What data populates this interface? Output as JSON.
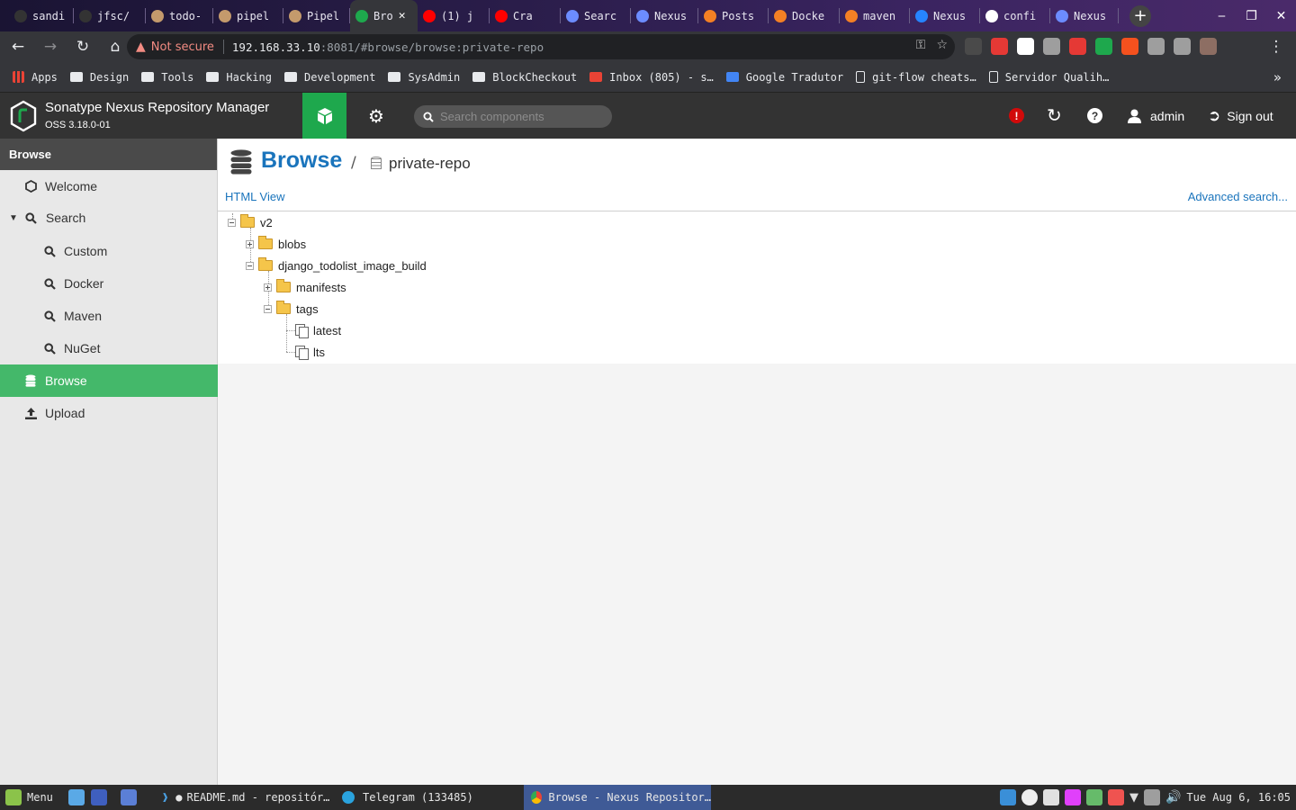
{
  "browser": {
    "tabs": [
      {
        "label": "sandi",
        "color": "#333333"
      },
      {
        "label": "jfsc/",
        "color": "#333333"
      },
      {
        "label": "todo-",
        "color": "#c49a6c"
      },
      {
        "label": "pipel",
        "color": "#c49a6c"
      },
      {
        "label": "Pipel",
        "color": "#c49a6c"
      },
      {
        "label": "Bro",
        "color": "#1ea84d",
        "active": true,
        "close": "✕"
      },
      {
        "label": "(1) j",
        "color": "#ff0000"
      },
      {
        "label": "Cra",
        "color": "#ff0000"
      },
      {
        "label": "Searc",
        "color": "#6c8cff"
      },
      {
        "label": "Nexus",
        "color": "#6c8cff"
      },
      {
        "label": "Posts",
        "color": "#f48024"
      },
      {
        "label": "Docke",
        "color": "#f48024"
      },
      {
        "label": "maven",
        "color": "#f48024"
      },
      {
        "label": "Nexus",
        "color": "#2684ff"
      },
      {
        "label": "confi",
        "color": "#ffffff"
      },
      {
        "label": "Nexus",
        "color": "#6c8cff"
      }
    ],
    "new_tab": "+",
    "window_controls": [
      "‒",
      "❐",
      "✕"
    ],
    "security_label": "Not secure",
    "url_host": "192.168.33.10",
    "url_rest": ":8081/#browse/browse:private-repo",
    "extension_colors": [
      "#4a4a4a",
      "#e53935",
      "#ffffff",
      "#9e9e9e",
      "#e53935",
      "#1ea84d",
      "#f4511e",
      "#9e9e9e",
      "#9e9e9e",
      "#8d6e63"
    ],
    "bookmarks": [
      {
        "label": "Apps",
        "icon": "apps"
      },
      {
        "label": "Design",
        "icon": "folder"
      },
      {
        "label": "Tools",
        "icon": "folder"
      },
      {
        "label": "Hacking",
        "icon": "folder"
      },
      {
        "label": "Development",
        "icon": "folder"
      },
      {
        "label": "SysAdmin",
        "icon": "folder"
      },
      {
        "label": "BlockCheckout",
        "icon": "folder"
      },
      {
        "label": "Inbox (805) - s…",
        "icon": "mail"
      },
      {
        "label": "Google Tradutor",
        "icon": "gt"
      },
      {
        "label": "git-flow cheats…",
        "icon": "doc"
      },
      {
        "label": "Servidor Qualih…",
        "icon": "doc"
      }
    ],
    "bookmarks_more": "»"
  },
  "nexus": {
    "title": "Sonatype Nexus Repository Manager",
    "version": "OSS 3.18.0-01",
    "search_placeholder": "Search components",
    "alert": "!",
    "user": "admin",
    "signout": "Sign out",
    "accent": "#1ea84d"
  },
  "sidebar": {
    "heading": "Browse",
    "items": [
      {
        "label": "Welcome"
      },
      {
        "label": "Search"
      },
      {
        "label": "Custom"
      },
      {
        "label": "Docker"
      },
      {
        "label": "Maven"
      },
      {
        "label": "NuGet"
      },
      {
        "label": "Browse"
      },
      {
        "label": "Upload"
      }
    ]
  },
  "main": {
    "title": "Browse",
    "crumb_sep": "/",
    "repo": "private-repo",
    "html_view": "HTML View",
    "advanced_search": "Advanced search...",
    "tree": {
      "v2": "v2",
      "blobs": "blobs",
      "image": "django_todolist_image_build",
      "manifests": "manifests",
      "tags": "tags",
      "latest": "latest",
      "lts": "lts"
    }
  },
  "taskbar": {
    "menu": "Menu",
    "windows": [
      {
        "label": "README.md - repositór…"
      },
      {
        "label": "Telegram (133485)"
      },
      {
        "label": "Browse - Nexus Repositor…"
      }
    ],
    "clock": "Tue Aug  6, 16:05"
  }
}
